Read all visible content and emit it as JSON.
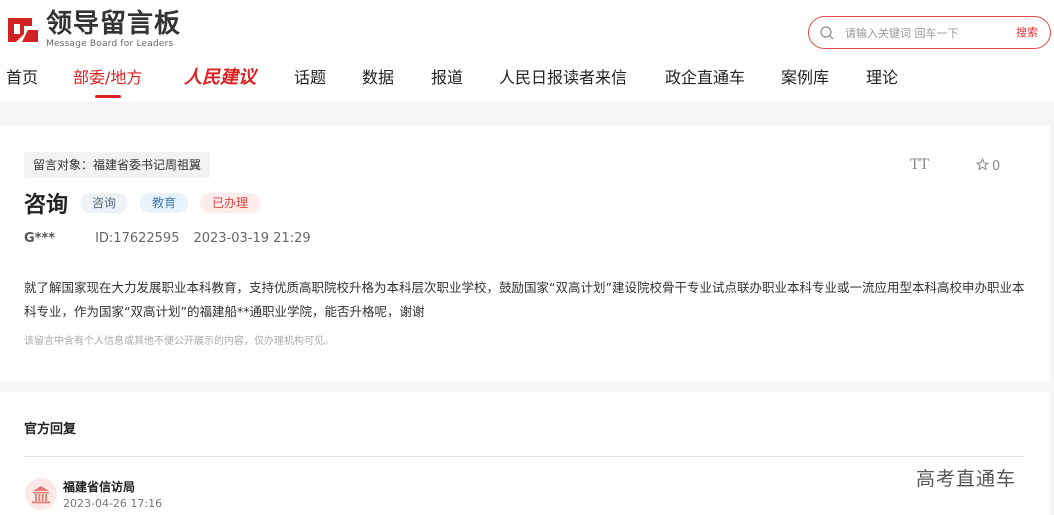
{
  "header": {
    "logo_cn": "领导留言板",
    "logo_en": "Message Board for Leaders"
  },
  "search": {
    "placeholder": "请输入关键词 回车一下",
    "button_label": "搜索"
  },
  "nav": {
    "items": [
      {
        "label": "首页"
      },
      {
        "label": "部委/地方"
      },
      {
        "label": "人民建议"
      },
      {
        "label": "话题"
      },
      {
        "label": "数据"
      },
      {
        "label": "报道"
      },
      {
        "label": "人民日报读者来信"
      },
      {
        "label": "政企直通车"
      },
      {
        "label": "案例库"
      },
      {
        "label": "理论"
      }
    ],
    "active_index": 1
  },
  "message": {
    "target": "留言对象：福建省委书记周祖翼",
    "fontsize_label": "TT",
    "fav_count": "0",
    "title": "咨询",
    "tags": [
      "咨询",
      "教育",
      "已办理"
    ],
    "author": "G***",
    "id": "ID:17622595",
    "time": "2023-03-19 21:29",
    "content": "就了解国家现在大力发展职业本科教育，支持优质高职院校升格为本科层次职业学校，鼓励国家“双高计划”建设院校骨干专业试点联办职业本科专业或一流应用型本科高校申办职业本科专业，作为国家“双高计划”的福建船**通职业学院，能否升格呢，谢谢",
    "notice": "该留言中含有个人信息或其他不便公开展示的内容，仅办理机构可见。"
  },
  "reply": {
    "section_title": "官方回复",
    "org_name": "福建省信访局",
    "time": "2023-04-26 17:16"
  },
  "watermark": "高考直通车",
  "colors": {
    "accent": "#d22222",
    "tag_red": "#e04545",
    "tag_blue": "#3d7bb0"
  }
}
